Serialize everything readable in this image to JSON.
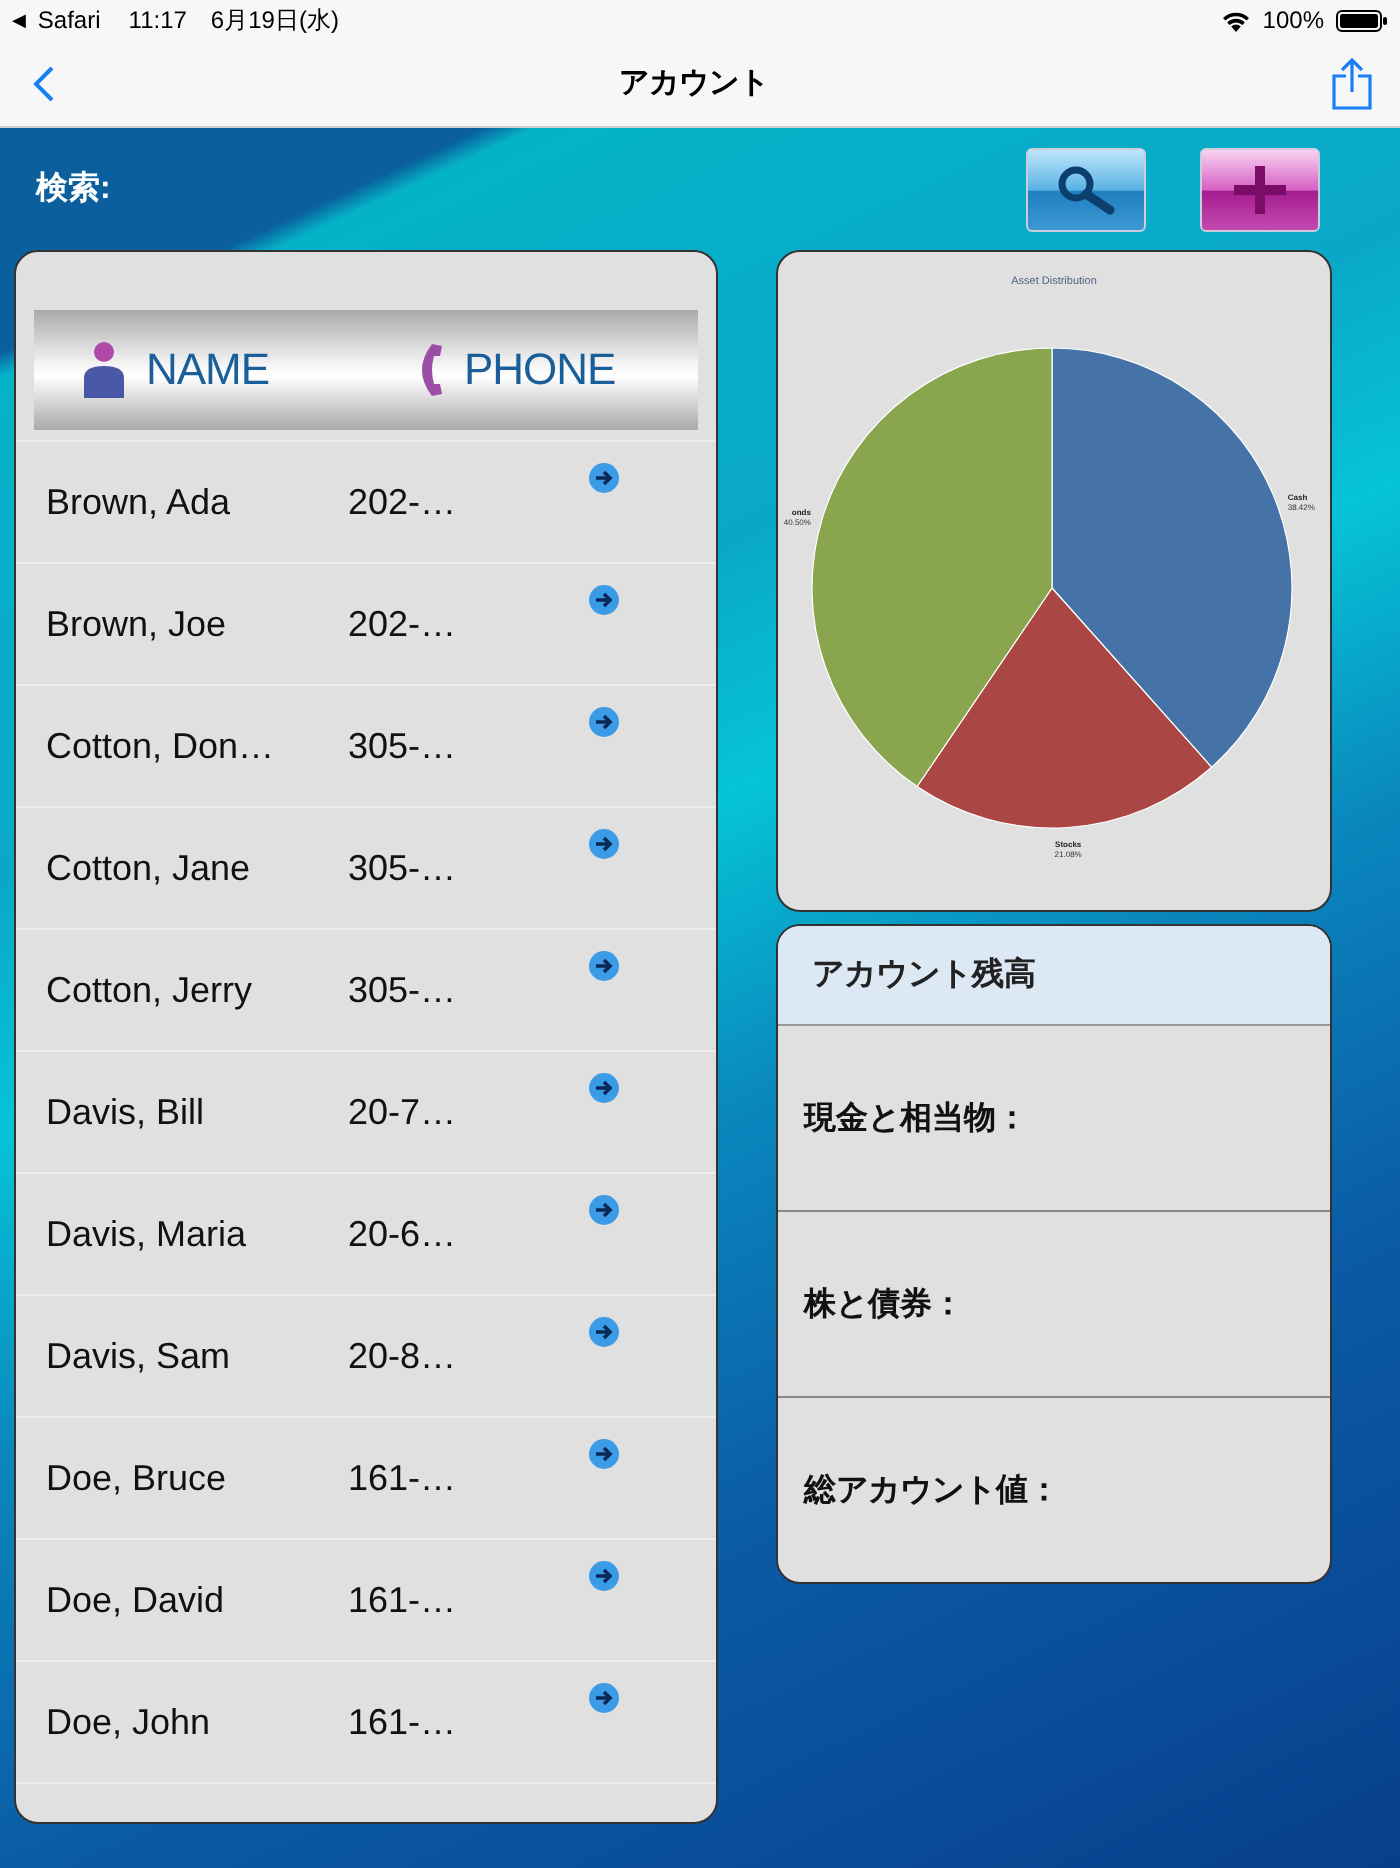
{
  "status_bar": {
    "back_glyph": "◀",
    "app": "Safari",
    "time": "11:17",
    "date": "6月19日(水)",
    "battery": "100%"
  },
  "nav_bar": {
    "title": "アカウント"
  },
  "toolbar": {
    "search_label": "検索:"
  },
  "contacts": {
    "columns": [
      "NAME",
      "PHONE"
    ],
    "rows": [
      {
        "name": "Brown, Ada",
        "phone": "202-…"
      },
      {
        "name": "Brown, Joe",
        "phone": "202-…"
      },
      {
        "name": "Cotton, Don…",
        "phone": "305-…"
      },
      {
        "name": "Cotton, Jane",
        "phone": "305-…"
      },
      {
        "name": "Cotton, Jerry",
        "phone": "305-…"
      },
      {
        "name": "Davis, Bill",
        "phone": "20-7…"
      },
      {
        "name": "Davis, Maria",
        "phone": "20-6…"
      },
      {
        "name": "Davis, Sam",
        "phone": "20-8…"
      },
      {
        "name": "Doe, Bruce",
        "phone": "161-…"
      },
      {
        "name": "Doe, David",
        "phone": "161-…"
      },
      {
        "name": "Doe, John",
        "phone": "161-…"
      }
    ]
  },
  "chart": {
    "chart_data": {
      "type": "pie",
      "title": "Asset Distribution",
      "categories": [
        "Cash",
        "Stocks",
        "onds"
      ],
      "values": [
        38.42,
        21.08,
        40.5
      ],
      "colors": [
        "#4572a7",
        "#aa4643",
        "#89a54e"
      ],
      "value_labels": [
        "38.42%",
        "21.08%",
        "40.50%"
      ]
    }
  },
  "balance": {
    "title": "アカウント残高",
    "rows": [
      "現金と相当物：",
      "株と債券：",
      "総アカウント値："
    ]
  }
}
